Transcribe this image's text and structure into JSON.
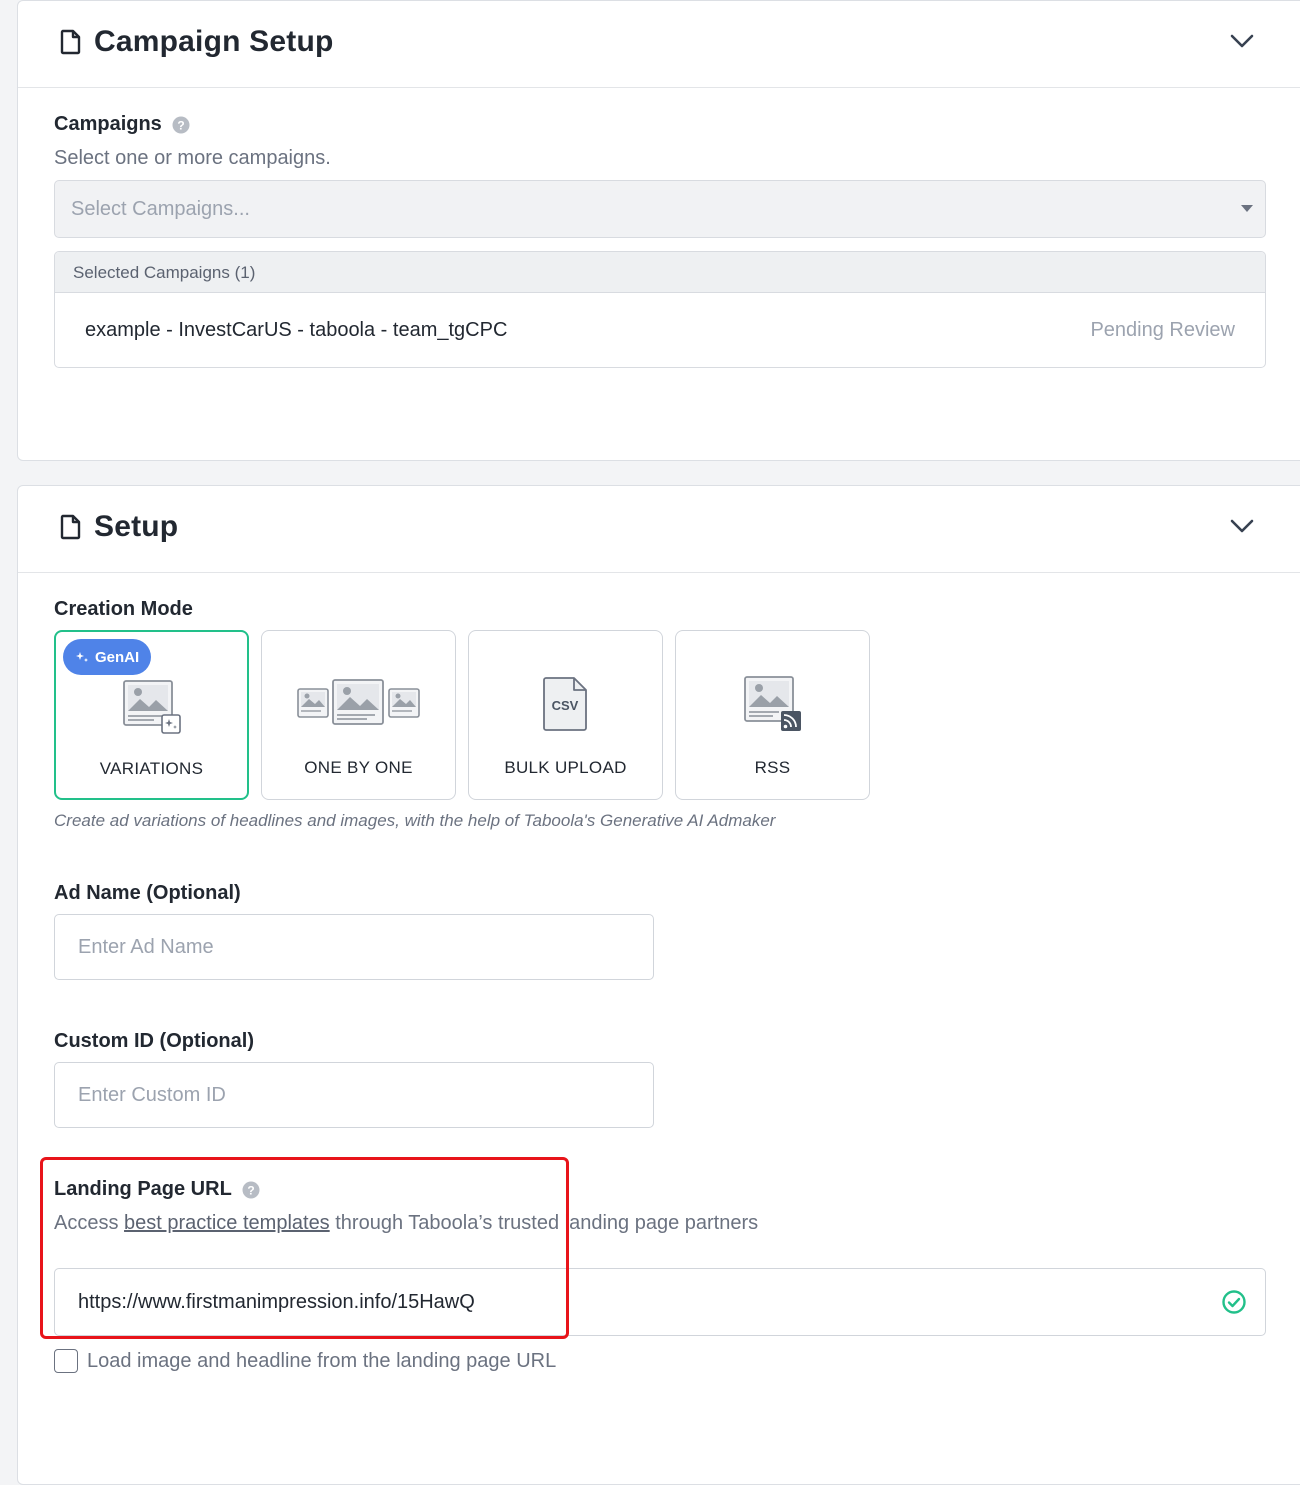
{
  "campaign_setup": {
    "title": "Campaign Setup",
    "campaigns_label": "Campaigns",
    "campaigns_help": "Select one or more campaigns.",
    "select_placeholder": "Select Campaigns...",
    "selected_header": "Selected Campaigns (1)",
    "selected": [
      {
        "name": "example - InvestCarUS - taboola - team_tgCPC",
        "status": "Pending Review"
      }
    ]
  },
  "setup": {
    "title": "Setup",
    "creation_mode_label": "Creation Mode",
    "modes": [
      {
        "label": "VARIATIONS",
        "selected": true,
        "badge": "GenAI"
      },
      {
        "label": "ONE BY ONE",
        "selected": false
      },
      {
        "label": "BULK UPLOAD",
        "selected": false,
        "icon_text": "CSV"
      },
      {
        "label": "RSS",
        "selected": false
      }
    ],
    "mode_hint": "Create ad variations of headlines and images, with the help of Taboola's Generative AI Admaker",
    "ad_name_label": "Ad Name (Optional)",
    "ad_name_placeholder": "Enter Ad Name",
    "custom_id_label": "Custom ID (Optional)",
    "custom_id_placeholder": "Enter Custom ID",
    "landing_label": "Landing Page URL",
    "landing_help_prefix": "Access ",
    "landing_help_link": "best practice templates",
    "landing_help_suffix": " through Taboola’s trusted landing page partners",
    "landing_url": "https://www.firstmanimpression.info/15HawQ",
    "load_checkbox_label": "Load image and headline from the landing page URL",
    "load_checkbox_checked": false
  },
  "colors": {
    "accent_green": "#22c08a",
    "genai_blue": "#4f83e8",
    "highlight_red": "#e8141a"
  },
  "icons": [
    "document-icon",
    "chevron-down-icon",
    "help-icon",
    "sparkle-icon",
    "image-icon",
    "csv-file-icon",
    "rss-icon",
    "check-circle-icon"
  ]
}
